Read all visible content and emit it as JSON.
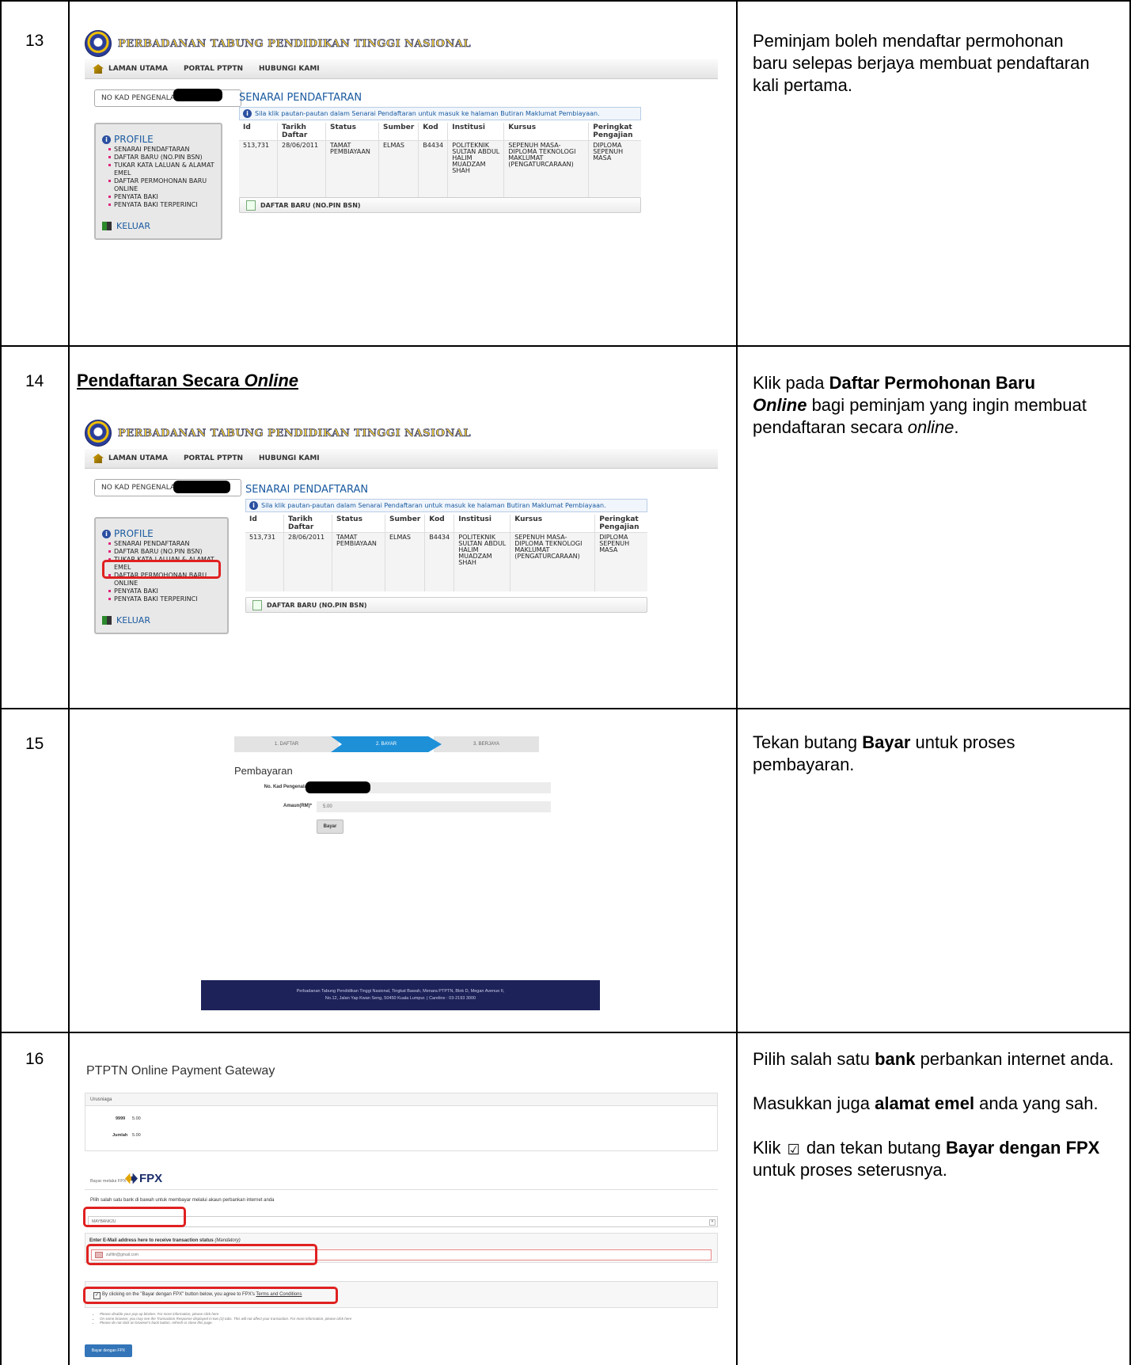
{
  "rows": [
    {
      "number": "13",
      "portal": {
        "logo_text": "Perbadanan Tabung Pendidikan Tinggi Nasional",
        "nav": [
          "LAMAN UTAMA",
          "PORTAL PTPTN",
          "HUBUNGI KAMI"
        ],
        "ic_label": "NO KAD PENGENALAN",
        "list_title": "SENARAI PENDAFTARAN",
        "notice": "Sila klik pautan-pautan dalam Senarai Pendaftaran untuk masuk ke halaman Butiran Maklumat Pembiayaan.",
        "table_headers": [
          "Id",
          "Tarikh Daftar",
          "Status",
          "Sumber",
          "Kod",
          "Institusi",
          "Kursus",
          "Peringkat Pengajian"
        ],
        "table_row": [
          "513,731",
          "28/06/2011",
          "TAMAT PEMBIAYAAN",
          "ELMAS",
          "B4434",
          "POLITEKNIK SULTAN ABDUL HALIM MUADZAM SHAH",
          "SEPENUH MASA- DIPLOMA TEKNOLOGI MAKLUMAT (PENGATURCARAAN)",
          "DIPLOMA SEPENUH MASA"
        ],
        "profile_label": "PROFILE",
        "menu": [
          "SENARAI PENDAFTARAN",
          "DAFTAR BARU (NO.PIN BSN)",
          "TUKAR KATA LALUAN & ALAMAT EMEL",
          "DAFTAR PERMOHONAN BARU ONLINE",
          "PENYATA BAKI",
          "PENYATA BAKI TERPERINCI"
        ],
        "logout": "KELUAR",
        "register_button": "DAFTAR BARU (NO.PIN BSN)"
      },
      "description": "Peminjam boleh mendaftar permohonan baru selepas berjaya membuat pendaftaran kali pertama."
    },
    {
      "number": "14",
      "heading_plain": "Pendaftaran Secara ",
      "heading_italic": "Online",
      "description_parts": {
        "a": "Klik pada ",
        "b": "Daftar Permohonan Baru",
        "c": "Online",
        "d": " bagi peminjam yang ingin membuat pendaftaran secara ",
        "e": "online",
        "f": "."
      }
    },
    {
      "number": "15",
      "steps": [
        "1. DAFTAR",
        "2. BAYAR",
        "3. BERJAYA"
      ],
      "payment_title": "Pembayaran",
      "ic_label": "No. Kad Pengenalan*",
      "amount_label": "Amaun(RM)*",
      "amount_value": "5.00",
      "pay_button": "Bayar",
      "footer_line1": "Perbadanan Tabung Pendidikan Tinggi Nasional, Tingkat Bawah, Menara PTPTN, Blok D, Megan Avenue II,",
      "footer_line2": "No.12, Jalan Yap Kwan Seng, 50450 Kuala Lumpur. | Careline : 03-2193 3000",
      "description_parts": {
        "a": "Tekan butang ",
        "b": "Bayar",
        "c": " untuk proses pembayaran."
      }
    },
    {
      "number": "16",
      "gateway_title": "PTPTN Online Payment Gateway",
      "txn_header": "Urusniaga",
      "txn_code": "9999",
      "txn_code_amount": "5.00",
      "total_label": "Jumlah",
      "total_amount": "5.00",
      "fpx_tab_label": "Bayar melalui FPX",
      "fpx_logo": "FPX",
      "bank_instruction": "Pilih salah satu bank di bawah untuk membayar melalui akaun perbankan internet anda",
      "bank_selected": "MAYBANK2U",
      "email_label": "Enter E-Mail address here to receive transaction status",
      "email_mandatory": "(Mandatory)",
      "email_value": "zulfitri@gmail.com",
      "agree_text": "By clicking on the \"Bayar dengan FPX\" button below, you agree to FPX's",
      "terms_link": "Terms and Conditions",
      "notes": [
        "Please disable your pop-up blocker. For more information, please click here",
        "On some browser, you may see the Transaction Response displayed in two (2) tabs. This will not affect your transaction. For more information, please click here",
        "Please do not click on browser's back button, refresh or close this page."
      ],
      "fpx_button": "Bayar dengan FPX",
      "description": {
        "p1a": "Pilih salah satu ",
        "p1b": "bank",
        "p1c": " perbankan internet anda.",
        "p2a": "Masukkan juga ",
        "p2b": "alamat emel",
        "p2c": " anda yang sah.",
        "p3a": "Klik ",
        "p3check": "☑",
        "p3b": " dan tekan butang ",
        "p3c": "Bayar dengan FPX",
        "p3d": " untuk proses seterusnya."
      }
    }
  ]
}
